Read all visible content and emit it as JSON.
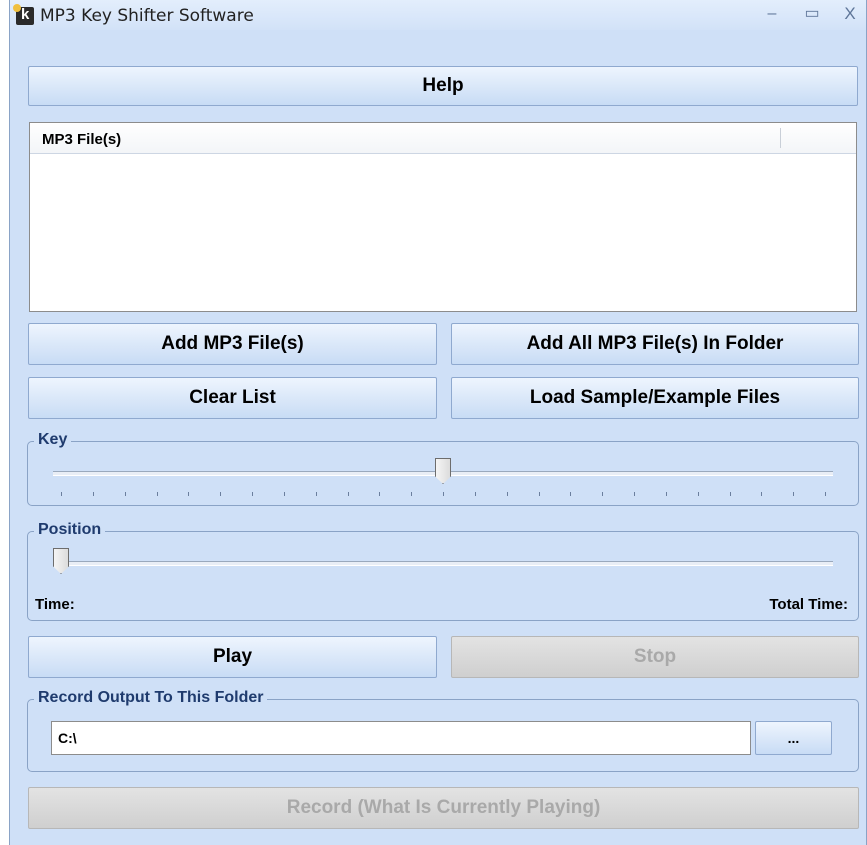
{
  "window": {
    "title": "MP3 Key Shifter Software",
    "controls": {
      "minimize": "–",
      "maximize": "▭",
      "close": "X"
    }
  },
  "help_button": "Help",
  "file_list": {
    "column_header": "MP3 File(s)",
    "items": []
  },
  "buttons": {
    "add_files": "Add MP3 File(s)",
    "add_folder": "Add All MP3 File(s) In Folder",
    "clear_list": "Clear List",
    "load_samples": "Load Sample/Example Files",
    "play": "Play",
    "stop": "Stop",
    "browse": "...",
    "record": "Record (What Is Currently Playing)"
  },
  "key_group": {
    "label": "Key",
    "slider_value": 0.5,
    "tick_count": 25
  },
  "position_group": {
    "label": "Position",
    "slider_value": 0.0,
    "time_label": "Time:",
    "total_time_label": "Total Time:"
  },
  "record_group": {
    "label": "Record Output To This Folder",
    "path_value": "C:\\"
  },
  "states": {
    "stop_enabled": false,
    "record_enabled": false
  },
  "colors": {
    "window_bg": "#cfe0f7",
    "group_label": "#1f3b6e",
    "disabled_text": "#a9a9a9"
  }
}
